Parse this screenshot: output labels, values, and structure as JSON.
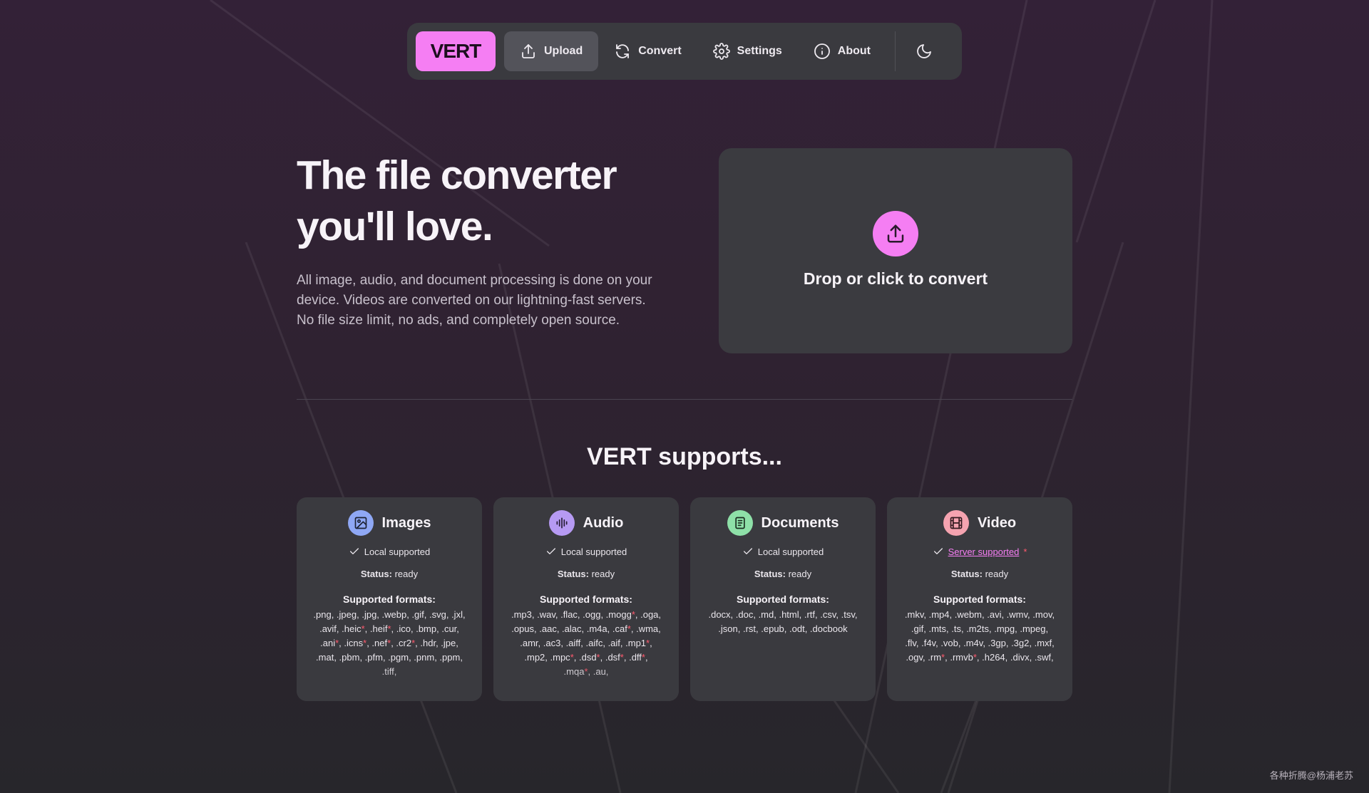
{
  "nav": {
    "logo": "VERT",
    "items": [
      {
        "label": "Upload",
        "icon": "upload-icon",
        "active": true
      },
      {
        "label": "Convert",
        "icon": "refresh-icon",
        "active": false
      },
      {
        "label": "Settings",
        "icon": "gear-icon",
        "active": false
      },
      {
        "label": "About",
        "icon": "info-icon",
        "active": false
      }
    ],
    "theme_icon": "moon-icon"
  },
  "hero": {
    "title_line1": "The file converter",
    "title_line2": "you'll love.",
    "description": "All image, audio, and document processing is done on your device. Videos are converted on our lightning-fast servers. No file size limit, no ads, and completely open source."
  },
  "dropzone": {
    "label": "Drop or click to convert",
    "icon": "upload-icon"
  },
  "supports": {
    "title": "VERT supports...",
    "status_label": "Status:",
    "formats_label": "Supported formats:",
    "cards": [
      {
        "title": "Images",
        "icon": "image-icon",
        "icon_color": "#8fa8f5",
        "support": "Local supported",
        "status": "ready",
        "formats": ".png, .jpeg, .jpg, .webp, .gif, .svg, .jxl, .avif, .heic*, .heif*, .ico, .bmp, .cur, .ani*, .icns*, .nef*, .cr2*, .hdr, .jpe, .mat, .pbm, .pfm, .pgm, .pnm, .ppm, .tiff,"
      },
      {
        "title": "Audio",
        "icon": "audio-wave-icon",
        "icon_color": "#b69af3",
        "support": "Local supported",
        "status": "ready",
        "formats": ".mp3, .wav, .flac, .ogg, .mogg*, .oga, .opus, .aac, .alac, .m4a, .caf*, .wma, .amr, .ac3, .aiff, .aifc, .aif, .mp1*, .mp2, .mpc*, .dsd*, .dsf*, .dff*, .mqa*, .au,"
      },
      {
        "title": "Documents",
        "icon": "document-icon",
        "icon_color": "#8ee0a8",
        "support": "Local supported",
        "status": "ready",
        "formats": ".docx, .doc, .md, .html, .rtf, .csv, .tsv, .json, .rst, .epub, .odt, .docbook"
      },
      {
        "title": "Video",
        "icon": "film-icon",
        "icon_color": "#f5a3b0",
        "support": "Server supported",
        "support_link": true,
        "status": "ready",
        "formats": ".mkv, .mp4, .webm, .avi, .wmv, .mov, .gif, .mts, .ts, .m2ts, .mpg, .mpeg, .flv, .f4v, .vob, .m4v, .3gp, .3g2, .mxf, .ogv, .rm*, .rmvb*, .h264, .divx, .swf,"
      }
    ]
  },
  "colors": {
    "accent": "#f57ef3",
    "panel": "#3a3a3f",
    "asterisk": "#ff5a6e"
  },
  "watermark": "各种折腾@杨浦老苏"
}
